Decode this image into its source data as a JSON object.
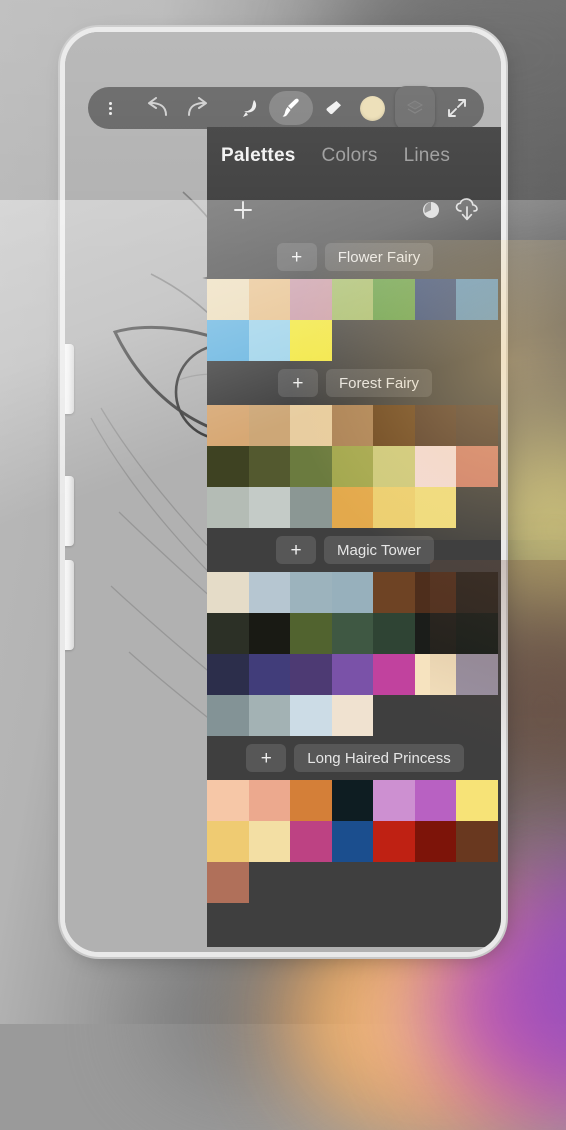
{
  "app": {
    "title": "Sketchbook Painting App",
    "canvas_artwork": "pencil-sketch-anime-eye"
  },
  "toolbar": {
    "items": [
      {
        "name": "menu",
        "icon": "three-dots-icon",
        "active": false
      },
      {
        "name": "undo",
        "icon": "undo-arrow-icon",
        "active": false
      },
      {
        "name": "redo",
        "icon": "redo-arrow-icon",
        "active": false
      },
      {
        "name": "smudge",
        "icon": "smudge-icon",
        "active": false
      },
      {
        "name": "brush",
        "icon": "paintbrush-icon",
        "active": true
      },
      {
        "name": "eraser",
        "icon": "eraser-icon",
        "active": false
      },
      {
        "name": "color",
        "icon": "color-swatch-circle-icon",
        "active": false
      },
      {
        "name": "layers",
        "icon": "layers-icon",
        "active": false
      },
      {
        "name": "fullscreen",
        "icon": "expand-arrows-icon",
        "active": false
      }
    ],
    "current_color": "#ecdeb5",
    "active_tool": "brush"
  },
  "panel": {
    "tabs": [
      {
        "label": "Palettes",
        "active": true
      },
      {
        "label": "Colors",
        "active": false
      },
      {
        "label": "Lines",
        "active": false
      }
    ],
    "actions": [
      {
        "name": "add-palette",
        "icon": "plus-icon",
        "label": "+"
      },
      {
        "name": "refresh-palettes",
        "icon": "refresh-circle-icon",
        "label": ""
      },
      {
        "name": "download-palettes",
        "icon": "cloud-download-icon",
        "label": ""
      }
    ],
    "add_label": "+",
    "palettes": [
      {
        "name": "Flower Fairy",
        "add_label": "+",
        "rows": [
          [
            "#ecdcb9",
            "#e7c08b",
            "#c99aa7",
            "#a3bd6d",
            "#5b9c45",
            "#26417a",
            "#4f8cc0"
          ],
          [
            "#66b4e0",
            "#9ed3ea",
            "#f2e840"
          ]
        ]
      },
      {
        "name": "Forest Fairy",
        "add_label": "+",
        "rows": [
          [
            "#d7a874",
            "#cda777",
            "#e8cda0",
            "#ac8358",
            "#6a4520",
            "#553c2c",
            "#4e3c32"
          ],
          [
            "#3e4222",
            "#53592f",
            "#6b7b3f",
            "#a3a84f",
            "#cdcb7e",
            "#f2dbd9",
            "#cf7f6c"
          ],
          [
            "#b4bcb5",
            "#c4cbc7",
            "#8b9794",
            "#e3a94c",
            "#ecd071",
            "#efdc7e"
          ]
        ]
      },
      {
        "name": "Magic Tower",
        "add_label": "+",
        "rows": [
          [
            "#e5dcc8",
            "#b6c6d1",
            "#9cb3bd",
            "#97b0bc",
            "#6e4324",
            "#4e2e1c",
            "#26231e"
          ],
          [
            "#2c3026",
            "#191a14",
            "#51632f",
            "#3f5843",
            "#2f4434",
            "#1b1d1a",
            "#131c19"
          ],
          [
            "#2c2e4b",
            "#413d7a",
            "#4d3a73",
            "#7a52a8",
            "#c1429e",
            "#f6e3bf",
            "#9a92a4"
          ],
          [
            "#839396",
            "#a3b2b4",
            "#ccdce6",
            "#f0e2d0"
          ]
        ]
      },
      {
        "name": "Long Haired Princess",
        "add_label": "+",
        "rows": [
          [
            "#f6c7a7",
            "#eca98e",
            "#d47f38",
            "#0e1d22",
            "#cd90d1",
            "#b861c2",
            "#f7e377"
          ],
          [
            "#efcb72",
            "#f3dfa4",
            "#bd4283",
            "#1b4e8e",
            "#bf2113",
            "#7d1409",
            "#69381f"
          ],
          [
            "#b0705a"
          ]
        ]
      }
    ]
  }
}
